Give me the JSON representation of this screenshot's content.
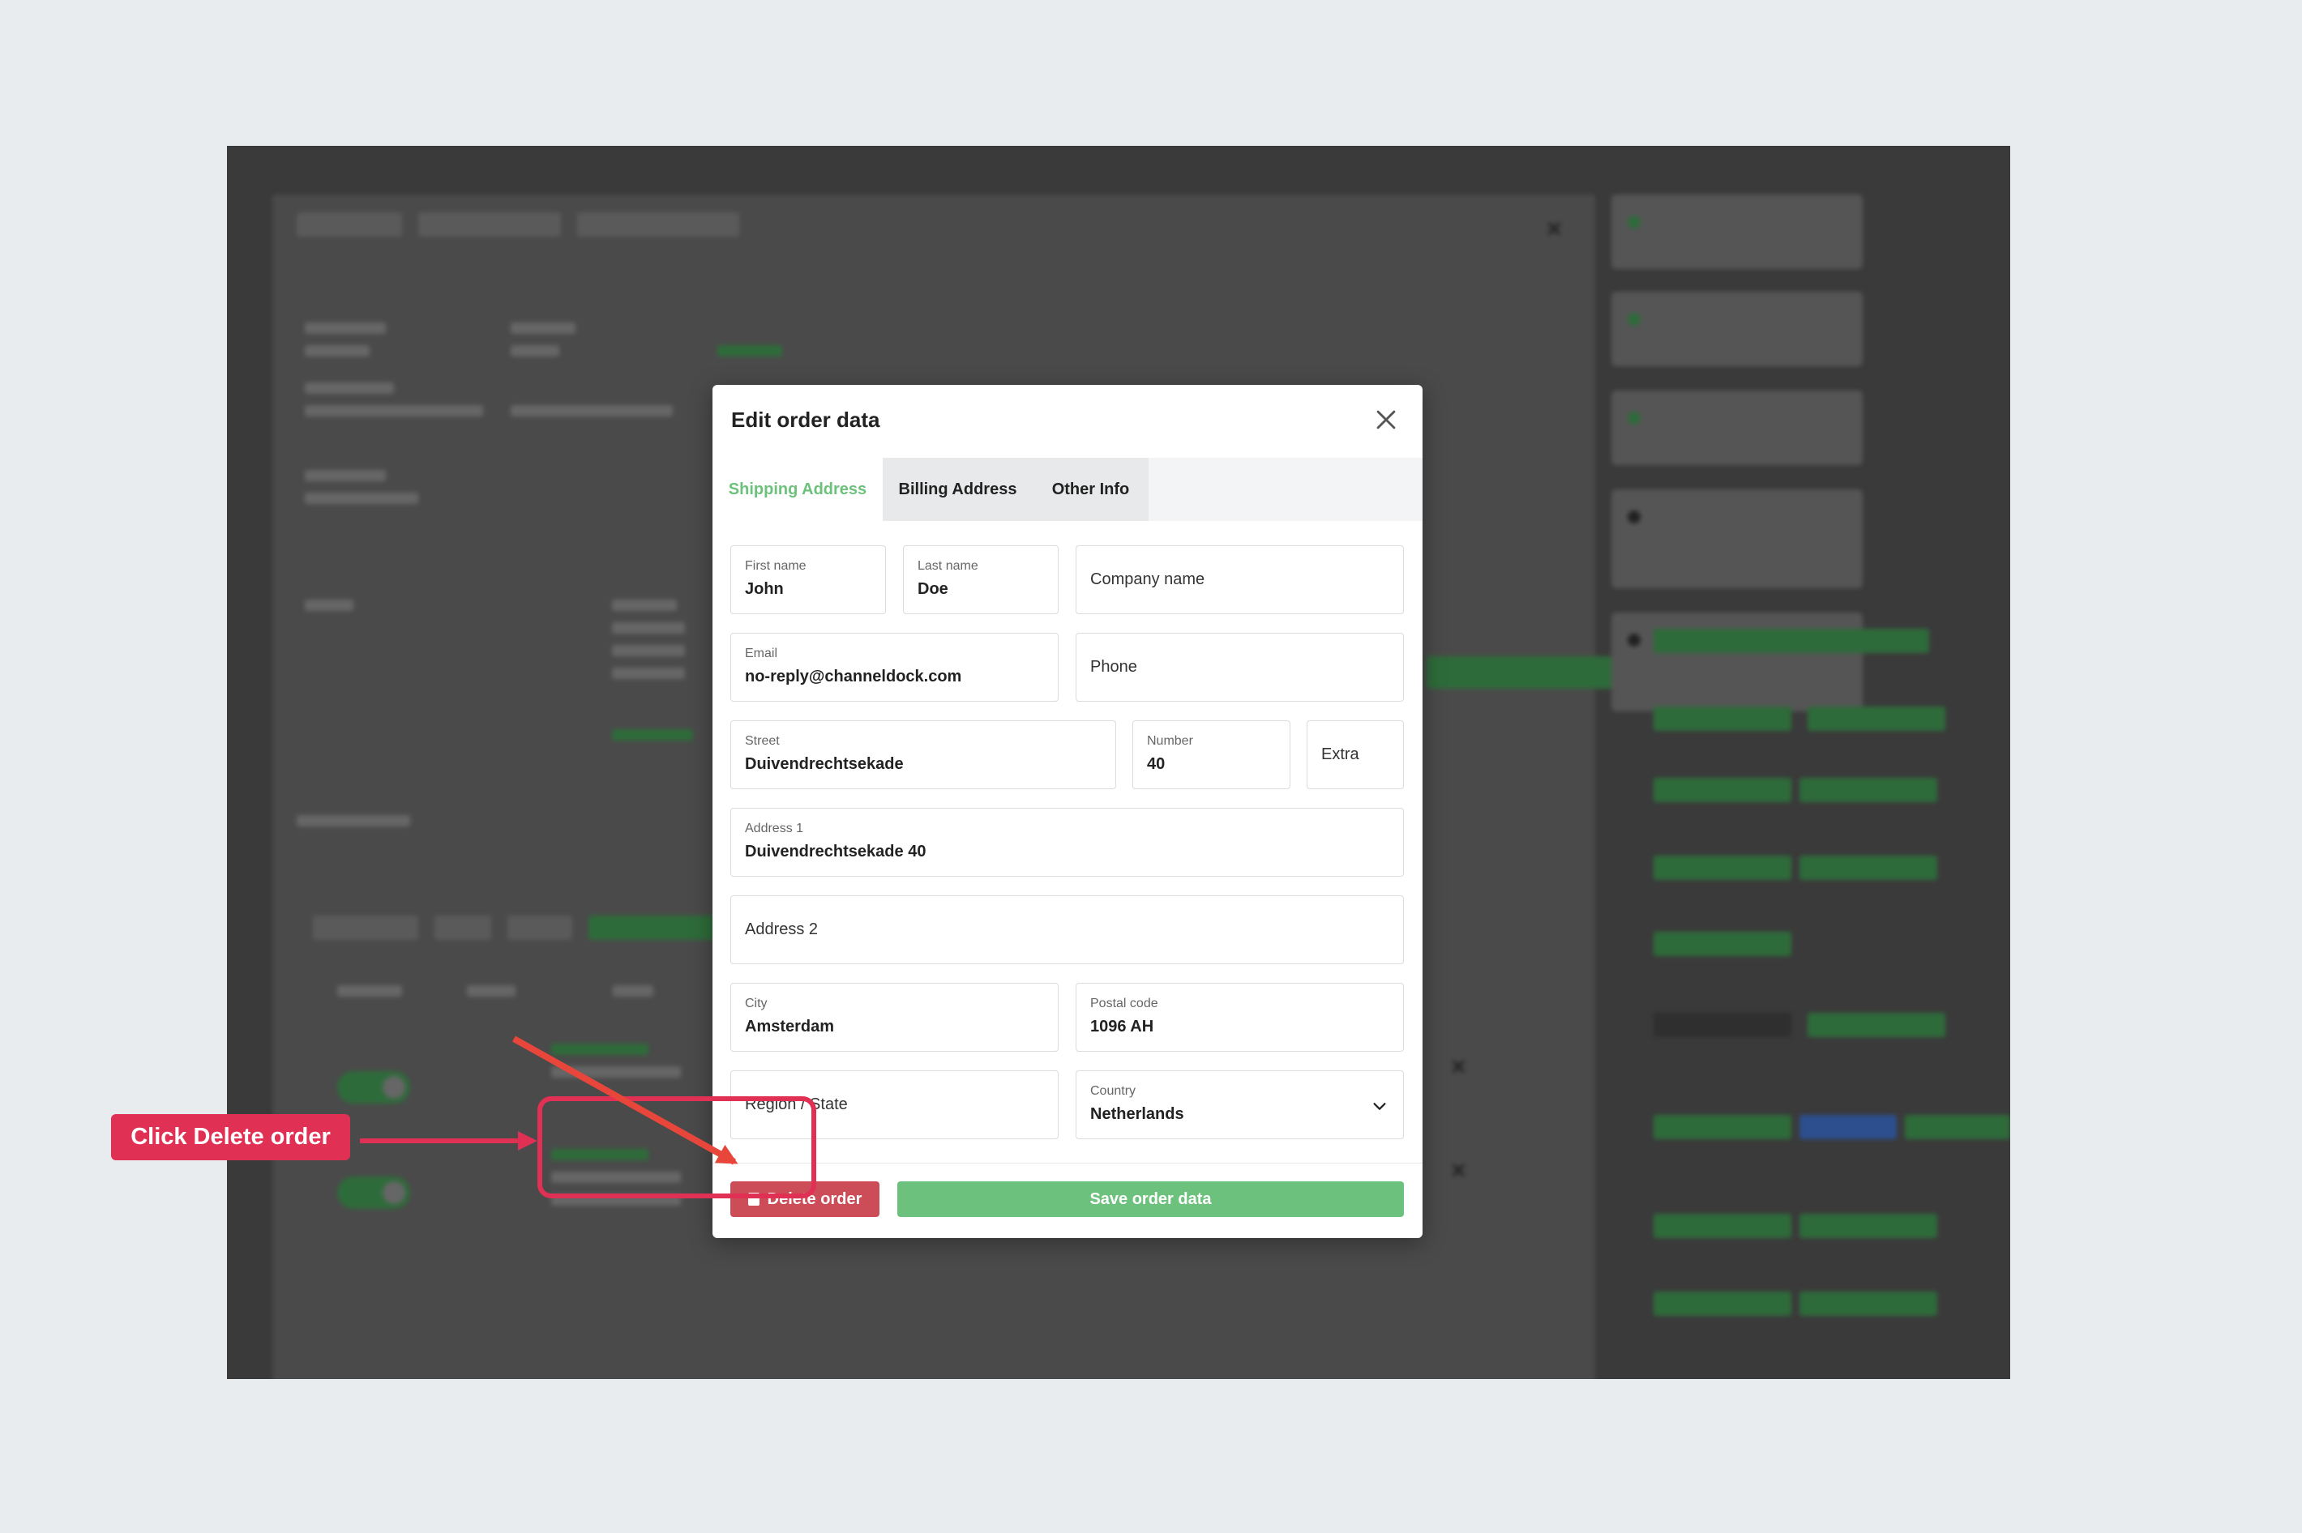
{
  "modal": {
    "title": "Edit order data",
    "tabs": [
      {
        "label": "Shipping Address",
        "active": true
      },
      {
        "label": "Billing Address",
        "active": false
      },
      {
        "label": "Other Info",
        "active": false
      }
    ],
    "fields": {
      "first_name": {
        "label": "First name",
        "value": "John"
      },
      "last_name": {
        "label": "Last name",
        "value": "Doe"
      },
      "company_name": {
        "placeholder": "Company name"
      },
      "email": {
        "label": "Email",
        "value": "no-reply@channeldock.com"
      },
      "phone": {
        "placeholder": "Phone"
      },
      "street": {
        "label": "Street",
        "value": "Duivendrechtsekade"
      },
      "number": {
        "label": "Number",
        "value": "40"
      },
      "extra": {
        "placeholder": "Extra"
      },
      "address1": {
        "label": "Address 1",
        "value": "Duivendrechtsekade 40"
      },
      "address2": {
        "placeholder": "Address 2"
      },
      "city": {
        "label": "City",
        "value": "Amsterdam"
      },
      "postal_code": {
        "label": "Postal code",
        "value": "1096 AH"
      },
      "region": {
        "placeholder": "Region / State"
      },
      "country": {
        "label": "Country",
        "value": "Netherlands"
      }
    },
    "buttons": {
      "delete": "Delete order",
      "save": "Save order data"
    }
  },
  "annotation": {
    "callout": "Click Delete order",
    "color": "#e03053"
  },
  "colors": {
    "accent_green": "#6cc17c",
    "danger_red": "#cc4d57",
    "page_bg": "#e9ecef"
  }
}
